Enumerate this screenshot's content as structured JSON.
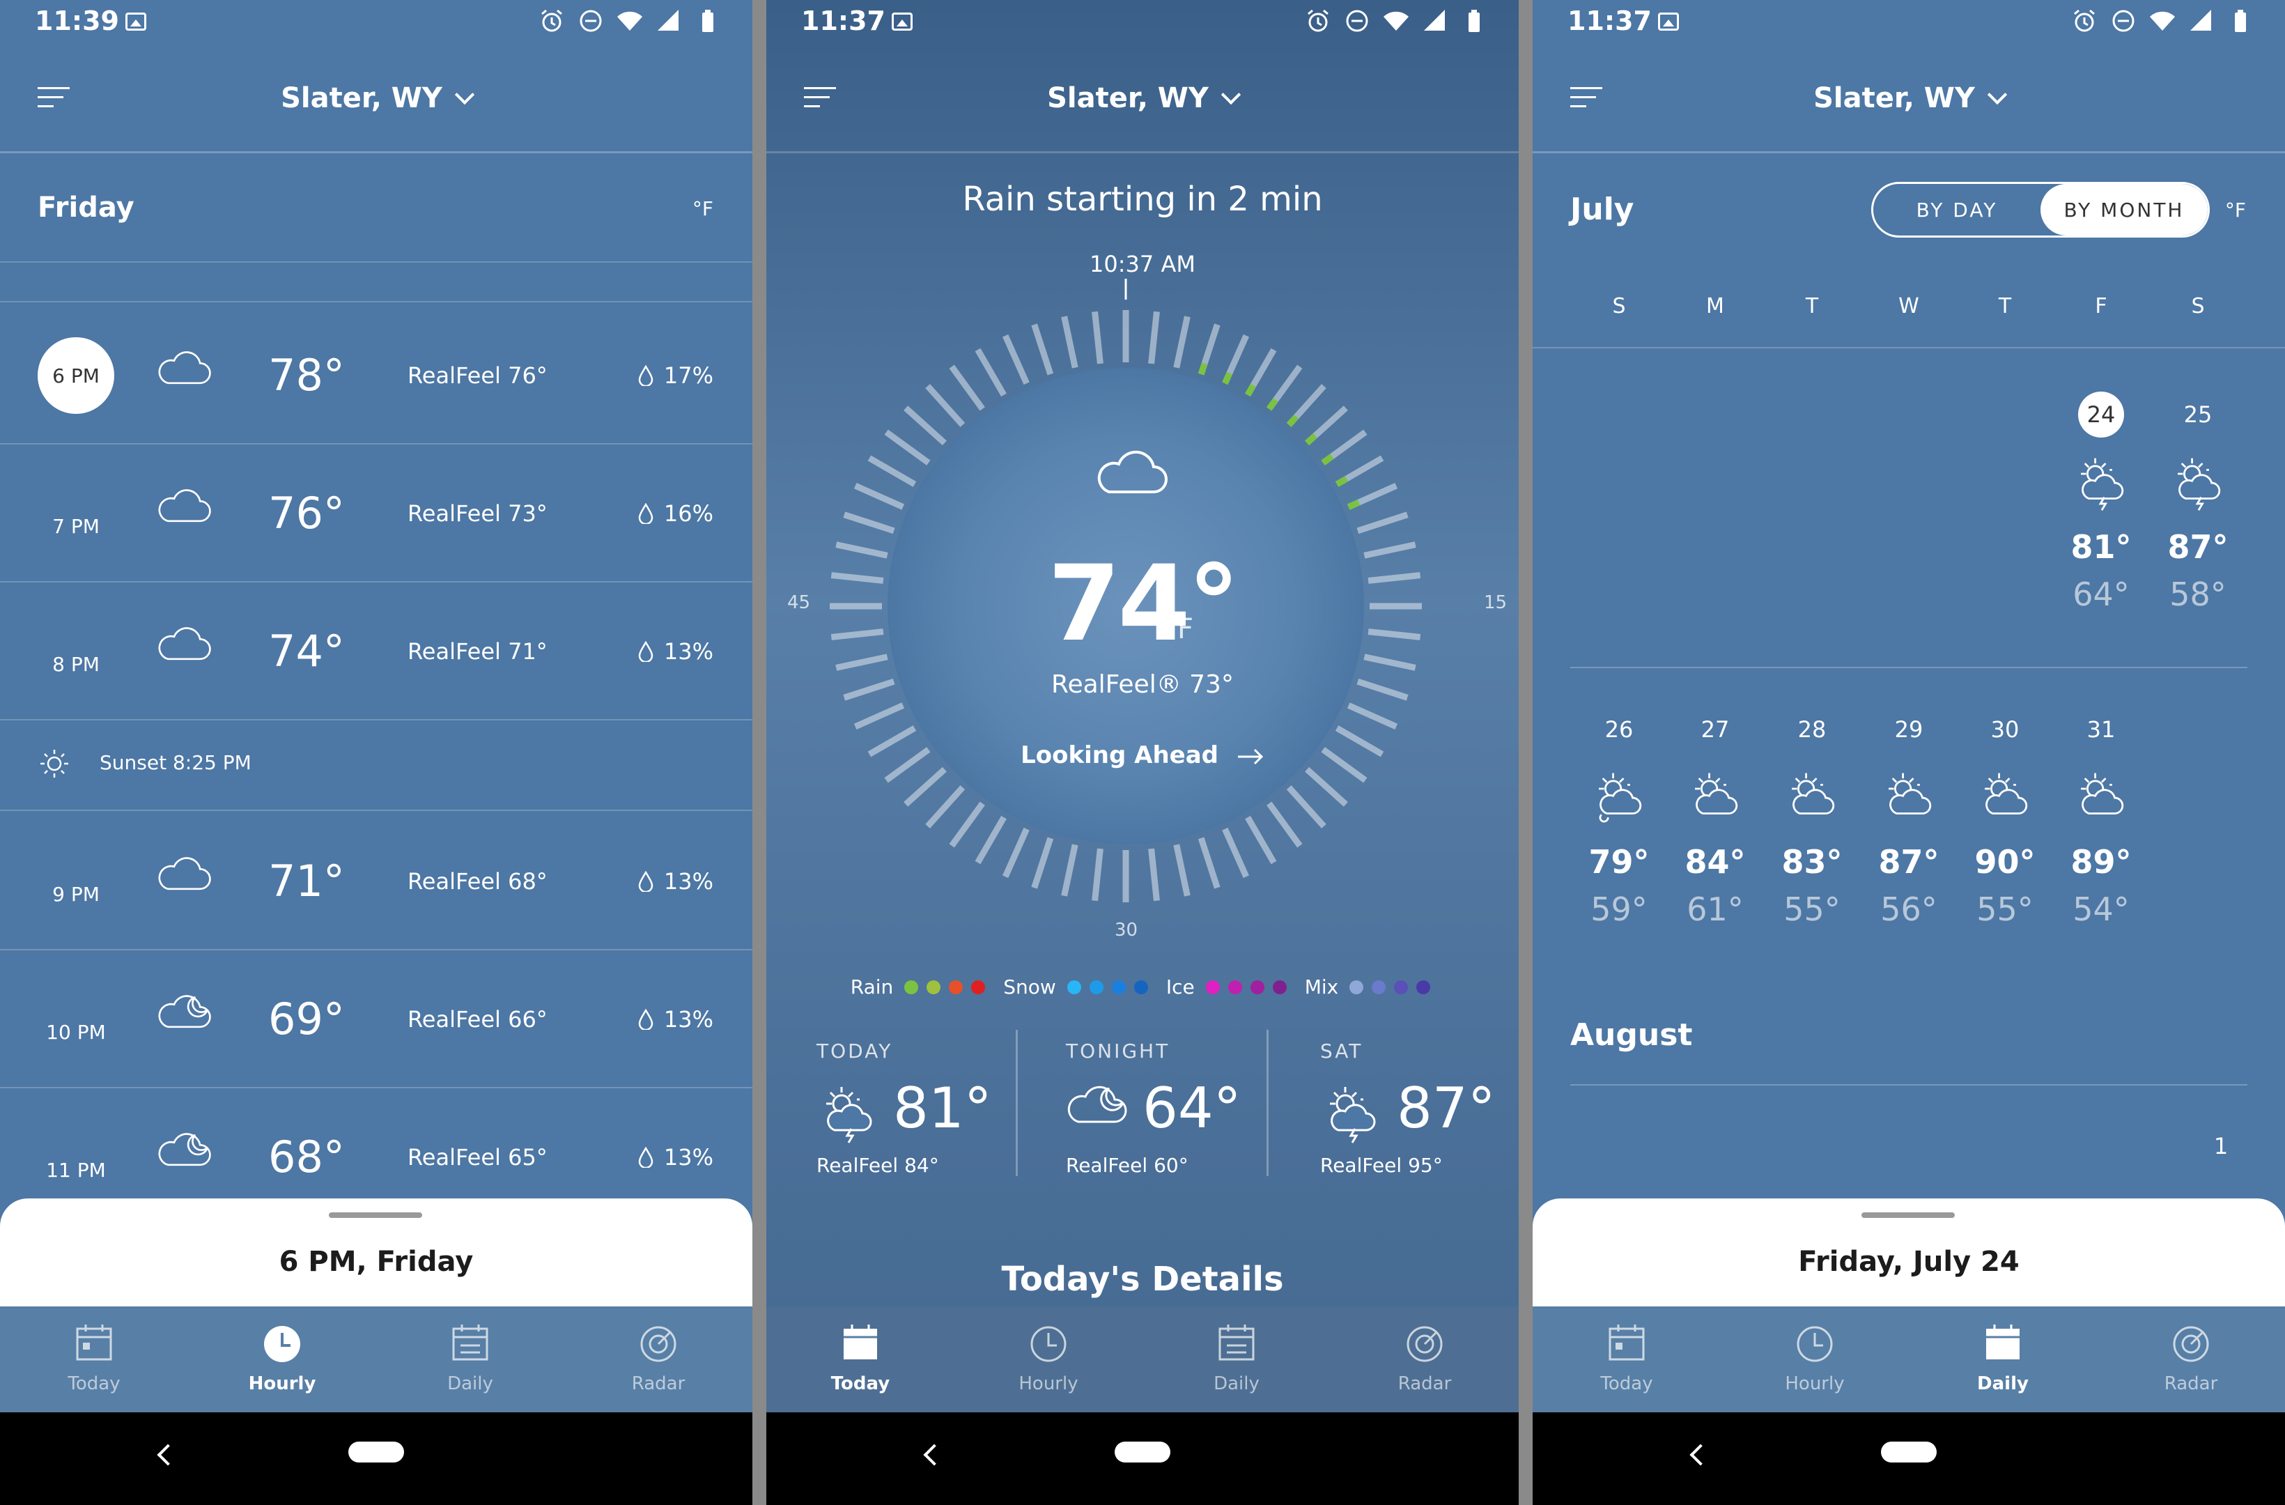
{
  "screens": {
    "hourly": {
      "status_time": "11:39",
      "location": "Slater, WY",
      "day_title": "Friday",
      "unit": "°F",
      "rows": [
        {
          "time": "6 PM",
          "icon": "cloud-icon",
          "temp": "78°",
          "realfeel": "RealFeel 76°",
          "precip": "17%"
        },
        {
          "time": "7 PM",
          "icon": "cloud-icon",
          "temp": "76°",
          "realfeel": "RealFeel 73°",
          "precip": "16%"
        },
        {
          "time": "8 PM",
          "icon": "cloud-icon",
          "temp": "74°",
          "realfeel": "RealFeel 71°",
          "precip": "13%"
        },
        {
          "time": "9 PM",
          "icon": "cloud-icon",
          "temp": "71°",
          "realfeel": "RealFeel 68°",
          "precip": "13%"
        },
        {
          "time": "10 PM",
          "icon": "cloud-moon-icon",
          "temp": "69°",
          "realfeel": "RealFeel 66°",
          "precip": "13%"
        },
        {
          "time": "11 PM",
          "icon": "cloud-moon-icon",
          "temp": "68°",
          "realfeel": "RealFeel 65°",
          "precip": "13%"
        }
      ],
      "sunset": "Sunset 8:25 PM",
      "sheet": "6 PM, Friday"
    },
    "today": {
      "status_time": "11:37",
      "location": "Slater, WY",
      "minutecast": "Rain starting in 2 min",
      "dial_time": "10:37 AM",
      "dial_labels": {
        "right": "15",
        "bottom": "30",
        "left": "45"
      },
      "temp": "74°",
      "temp_unit": "F",
      "realfeel": "RealFeel® 73°",
      "looking_ahead": "Looking Ahead",
      "legend": [
        {
          "label": "Rain",
          "colors": [
            "#7cc242",
            "#a0c040",
            "#e8502a",
            "#e02020"
          ]
        },
        {
          "label": "Snow",
          "colors": [
            "#29b6f6",
            "#1e9be8",
            "#1a80e0",
            "#1565c0"
          ]
        },
        {
          "label": "Ice",
          "colors": [
            "#e020c0",
            "#c020b0",
            "#a020a0",
            "#802090"
          ]
        },
        {
          "label": "Mix",
          "colors": [
            "#8fa8d8",
            "#6a7acc",
            "#5a50b8",
            "#4a3aa8"
          ]
        }
      ],
      "forecast": [
        {
          "label": "TODAY",
          "icon": "sun-cloud-storm-icon",
          "temp": "81°",
          "realfeel": "RealFeel 84°"
        },
        {
          "label": "TONIGHT",
          "icon": "cloud-moon-icon",
          "temp": "64°",
          "realfeel": "RealFeel 60°"
        },
        {
          "label": "SAT",
          "icon": "sun-cloud-storm-icon",
          "temp": "87°",
          "realfeel": "RealFeel 95°"
        }
      ],
      "details_title": "Today's Details"
    },
    "daily": {
      "status_time": "11:37",
      "location": "Slater, WY",
      "month": "July",
      "toggle": [
        "BY DAY",
        "BY MONTH"
      ],
      "unit": "°F",
      "weekdays": [
        "S",
        "M",
        "T",
        "W",
        "T",
        "F",
        "S"
      ],
      "week1": [
        {
          "date": "24",
          "hi": "81°",
          "lo": "64°",
          "icon": "sun-cloud-storm-icon",
          "active": true
        },
        {
          "date": "25",
          "hi": "87°",
          "lo": "58°",
          "icon": "sun-cloud-storm-icon",
          "active": false
        }
      ],
      "week2": [
        {
          "date": "26",
          "hi": "79°",
          "lo": "59°",
          "icon": "sun-cloud-rain-icon"
        },
        {
          "date": "27",
          "hi": "84°",
          "lo": "61°",
          "icon": "sun-cloud-icon"
        },
        {
          "date": "28",
          "hi": "83°",
          "lo": "55°",
          "icon": "sun-cloud-icon"
        },
        {
          "date": "29",
          "hi": "87°",
          "lo": "56°",
          "icon": "sun-cloud-icon"
        },
        {
          "date": "30",
          "hi": "90°",
          "lo": "55°",
          "icon": "sun-cloud-icon"
        },
        {
          "date": "31",
          "hi": "89°",
          "lo": "54°",
          "icon": "sun-cloud-icon"
        }
      ],
      "next_month": "August",
      "next_first": "1",
      "sheet": "Friday, July 24"
    }
  },
  "tabs": [
    "Today",
    "Hourly",
    "Daily",
    "Radar"
  ],
  "colors": {
    "dial_active": "#7cc242",
    "bg": "#4d77a4"
  }
}
